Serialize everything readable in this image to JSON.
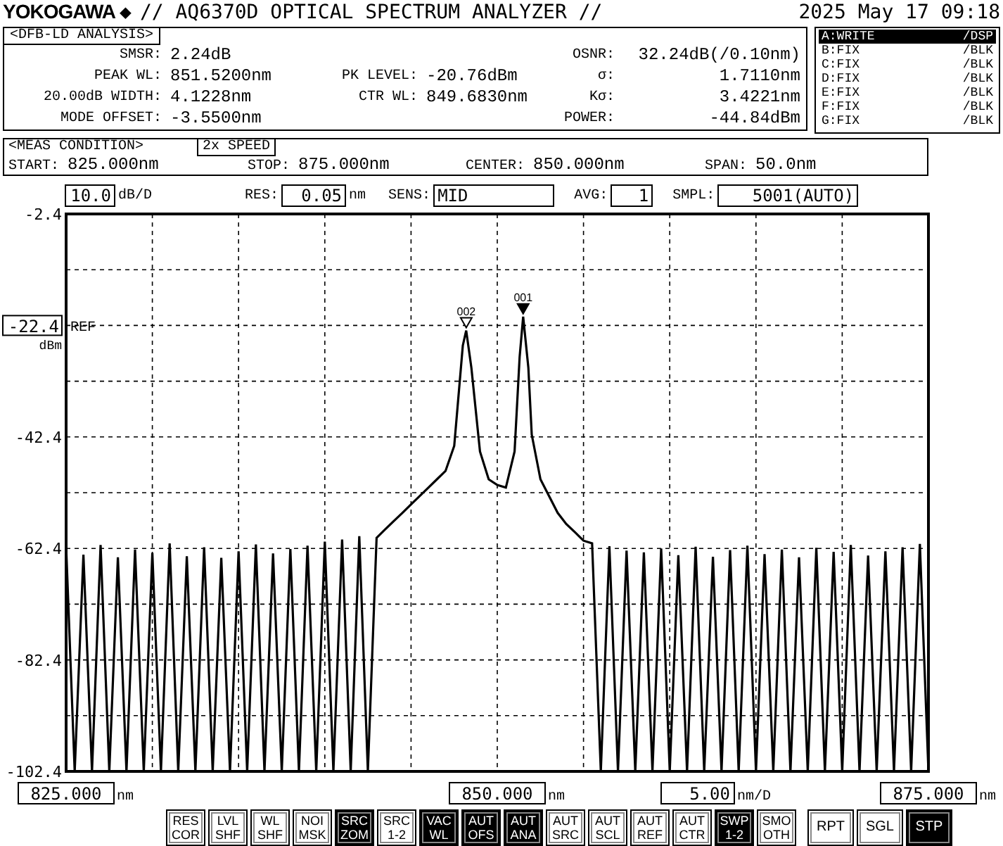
{
  "header": {
    "brand": "YOKOGAWA",
    "brand_mark": "◆",
    "title": "// AQ6370D OPTICAL SPECTRUM ANALYZER //",
    "datetime": "2025 May 17 09:18"
  },
  "analysis": {
    "title": "<DFB-LD ANALYSIS>",
    "rows": [
      {
        "left": {
          "label": "SMSR:",
          "value": "2.24dB"
        },
        "right": {
          "label": "OSNR:",
          "value": "32.24dB(/0.10nm)"
        }
      },
      {
        "left": {
          "label": "PEAK WL:",
          "value": "851.5200nm"
        },
        "middle": {
          "label": "PK LEVEL:",
          "value": "-20.76dBm"
        },
        "right": {
          "label": "σ:",
          "value": "1.7110nm"
        }
      },
      {
        "left": {
          "label": "20.00dB WIDTH:",
          "value": "4.1228nm"
        },
        "middle": {
          "label": "CTR WL:",
          "value": "849.6830nm"
        },
        "right": {
          "label": "Kσ:",
          "value": "3.4221nm"
        }
      },
      {
        "left": {
          "label": "MODE OFFSET:",
          "value": "-3.5500nm"
        },
        "right": {
          "label": "POWER:",
          "value": "-44.84dBm"
        }
      }
    ]
  },
  "traces": [
    {
      "name": "A:WRITE",
      "mode": "/DSP",
      "selected": true
    },
    {
      "name": "B:FIX",
      "mode": "/BLK",
      "selected": false
    },
    {
      "name": "C:FIX",
      "mode": "/BLK",
      "selected": false
    },
    {
      "name": "D:FIX",
      "mode": "/BLK",
      "selected": false
    },
    {
      "name": "E:FIX",
      "mode": "/BLK",
      "selected": false
    },
    {
      "name": "F:FIX",
      "mode": "/BLK",
      "selected": false
    },
    {
      "name": "G:FIX",
      "mode": "/BLK",
      "selected": false
    }
  ],
  "meas_condition": {
    "title": "<MEAS CONDITION>",
    "badge": "2x SPEED",
    "fields": [
      {
        "label": "START:",
        "value": "825.000nm"
      },
      {
        "label": "STOP:",
        "value": "875.000nm"
      },
      {
        "label": "CENTER:",
        "value": "850.000nm"
      },
      {
        "label": "SPAN:",
        "value": "50.0nm"
      }
    ]
  },
  "settings": [
    {
      "value": "10.0",
      "unit": "dB/D"
    },
    {
      "label": "RES:",
      "value": "0.05",
      "unit": "nm"
    },
    {
      "label": "SENS:",
      "value": "MID"
    },
    {
      "label": "AVG:",
      "value": "1"
    },
    {
      "label": "SMPL:",
      "value": "5001(AUTO)"
    }
  ],
  "reference": {
    "value": "-22.4",
    "label": "REF",
    "unit": "dBm"
  },
  "chart_data": {
    "type": "line",
    "grid": true,
    "xlim": [
      825,
      875
    ],
    "ylim": [
      -102.4,
      -2.4
    ],
    "yticks": [
      {
        "value": -2.4,
        "label": "-2.4"
      },
      {
        "value": -42.4,
        "label": "-42.4"
      },
      {
        "value": -62.4,
        "label": "-62.4"
      },
      {
        "value": -82.4,
        "label": "-82.4"
      },
      {
        "value": -102.4,
        "label": "-102.4"
      }
    ],
    "x": [
      825,
      825.5,
      826,
      826.5,
      827,
      827.5,
      828,
      828.5,
      829,
      829.5,
      830,
      830.5,
      831,
      831.5,
      832,
      832.5,
      833,
      833.5,
      834,
      834.5,
      835,
      835.5,
      836,
      836.5,
      837,
      837.5,
      838,
      838.5,
      839,
      839.5,
      840,
      840.5,
      841,
      841.5,
      842,
      842.5,
      843,
      843.5,
      844,
      844.5,
      845,
      845.5,
      846,
      846.5,
      847,
      847.5,
      848,
      848.2,
      848.5,
      849,
      849.5,
      850,
      850.5,
      851,
      851.3,
      851.5,
      851.8,
      852,
      852.5,
      853,
      853.5,
      854,
      854.5,
      855,
      855.5,
      856,
      856.5,
      857,
      857.5,
      858,
      858.5,
      859,
      859.5,
      860,
      860.5,
      861,
      861.5,
      862,
      862.5,
      863,
      863.5,
      864,
      864.5,
      865,
      865.5,
      866,
      866.5,
      867,
      867.5,
      868,
      868.5,
      869,
      869.5,
      870,
      870.5,
      871,
      871.5,
      872,
      872.5,
      873,
      873.5,
      874,
      874.5,
      875
    ],
    "series": [
      {
        "color": "#000000",
        "values": [
          -62.0,
          -102.4,
          -63.5,
          -102.4,
          -61.8,
          -102.4,
          -64.0,
          -102.4,
          -62.6,
          -102.4,
          -63.2,
          -102.4,
          -61.5,
          -102.4,
          -63.8,
          -102.4,
          -62.2,
          -102.4,
          -64.1,
          -102.4,
          -62.9,
          -102.4,
          -61.7,
          -102.4,
          -63.3,
          -102.4,
          -62.5,
          -102.4,
          -61.9,
          -102.4,
          -61.2,
          -102.4,
          -60.8,
          -102.4,
          -60.2,
          -102.4,
          -60.5,
          -59.0,
          -57.5,
          -56.0,
          -54.5,
          -53.0,
          -51.5,
          -50.0,
          -48.5,
          -44.0,
          -26.0,
          -23.3,
          -30.0,
          -45.0,
          -50.0,
          -51.0,
          -51.5,
          -45.0,
          -28.0,
          -20.8,
          -30.0,
          -42.0,
          -50.0,
          -53.0,
          -56.0,
          -58.0,
          -59.5,
          -61.0,
          -61.5,
          -102.4,
          -62.0,
          -102.4,
          -62.8,
          -102.4,
          -63.1,
          -102.4,
          -62.4,
          -102.4,
          -63.6,
          -102.4,
          -62.1,
          -102.4,
          -63.9,
          -102.4,
          -62.7,
          -102.4,
          -61.9,
          -102.4,
          -63.4,
          -102.4,
          -62.6,
          -102.4,
          -64.0,
          -102.4,
          -62.3,
          -102.4,
          -63.0,
          -102.4,
          -61.8,
          -102.4,
          -63.7,
          -102.4,
          -62.9,
          -102.4,
          -62.2,
          -102.4,
          -61.6,
          -102.4
        ]
      }
    ],
    "xticks": [
      {
        "value": 825,
        "label": "825.000"
      },
      {
        "value": 850,
        "label": "850.000"
      },
      {
        "value": 875,
        "label": "875.000"
      }
    ],
    "annotations": [
      {
        "text": "002",
        "x": 848.2,
        "y": -23.3
      },
      {
        "text": "001",
        "x": 851.5,
        "y": -20.8
      }
    ]
  },
  "markers": [
    {
      "active": false
    },
    {
      "active": true
    }
  ],
  "x_axis": {
    "units": [
      "nm",
      "nm",
      "nm"
    ],
    "scale": {
      "value": "5.00",
      "unit": "nm/D"
    }
  },
  "function_keys": [
    {
      "lines": [
        "RES",
        "COR"
      ],
      "on": false
    },
    {
      "lines": [
        "LVL",
        "SHF"
      ],
      "on": false
    },
    {
      "lines": [
        "WL",
        "SHF"
      ],
      "on": false
    },
    {
      "lines": [
        "NOI",
        "MSK"
      ],
      "on": false
    },
    {
      "lines": [
        "SRC",
        "ZOM"
      ],
      "on": true
    },
    {
      "lines": [
        "SRC",
        "1-2"
      ],
      "on": false
    },
    {
      "lines": [
        "VAC",
        "WL"
      ],
      "on": true
    },
    {
      "lines": [
        "AUT",
        "OFS"
      ],
      "on": true
    },
    {
      "lines": [
        "AUT",
        "ANA"
      ],
      "on": true
    },
    {
      "lines": [
        "AUT",
        "SRC"
      ],
      "on": false
    },
    {
      "lines": [
        "AUT",
        "SCL"
      ],
      "on": false
    },
    {
      "lines": [
        "AUT",
        "REF"
      ],
      "on": false
    },
    {
      "lines": [
        "AUT",
        "CTR"
      ],
      "on": false
    },
    {
      "lines": [
        "SWP",
        "1-2"
      ],
      "on": true
    },
    {
      "lines": [
        "SMO",
        "OTH"
      ],
      "on": false
    }
  ],
  "sweep_keys": [
    {
      "label": "RPT",
      "on": false
    },
    {
      "label": "SGL",
      "on": false
    },
    {
      "label": "STP",
      "on": true
    }
  ]
}
